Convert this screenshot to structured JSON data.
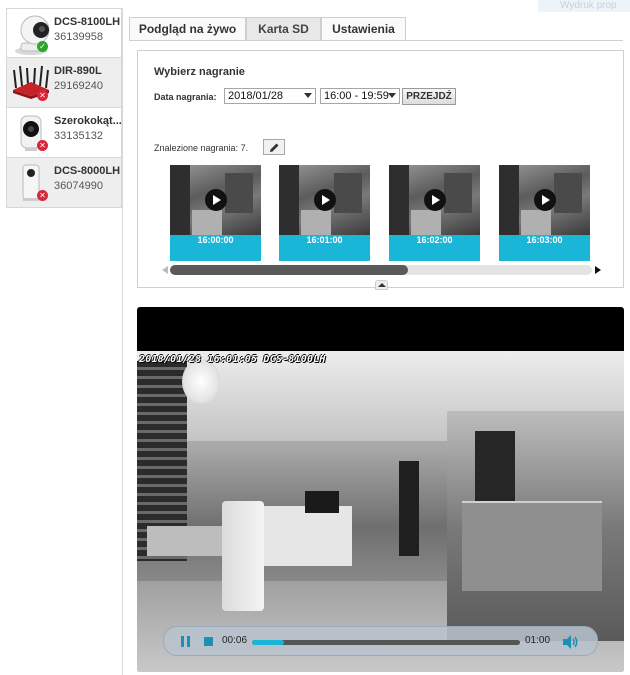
{
  "top_link": "Wydruk prop",
  "devices": [
    {
      "name": "DCS-8100LH",
      "serial": "36139958",
      "status": "ok",
      "icon": "camera-round-icon"
    },
    {
      "name": "DIR-890L",
      "serial": "29169240",
      "status": "error",
      "icon": "router-icon"
    },
    {
      "name": "Szerokokąt...",
      "serial": "33135132",
      "status": "error",
      "icon": "camera-wide-icon"
    },
    {
      "name": "DCS-8000LH",
      "serial": "36074990",
      "status": "error",
      "icon": "camera-cube-icon"
    }
  ],
  "tabs": [
    {
      "label": "Podgląd na żywo",
      "active": false
    },
    {
      "label": "Karta SD",
      "active": true
    },
    {
      "label": "Ustawienia",
      "active": false
    }
  ],
  "sd": {
    "title": "Wybierz nagranie",
    "date_label": "Data nagrania:",
    "date_value": "2018/01/28",
    "time_value": "16:00 - 19:59",
    "go_label": "PRZEJDŹ",
    "found_label": "Znalezione nagrania:",
    "found_count": "7.",
    "recordings": [
      "16:00:00",
      "16:01:00",
      "16:02:00",
      "16:03:00"
    ]
  },
  "player": {
    "osd": "2018/01/28 16:01:05 DCS-8100LH",
    "current_time": "00:06",
    "duration": "01:00",
    "progress": 0.12,
    "accent": "#1ab6d8"
  }
}
